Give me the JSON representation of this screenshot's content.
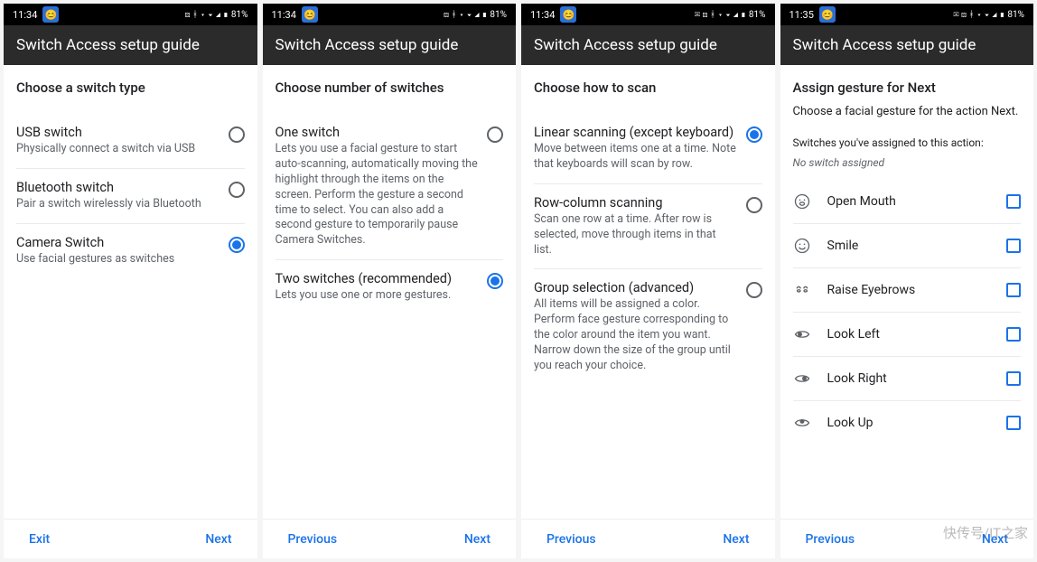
{
  "status": {
    "battery": "81%"
  },
  "appbar_title": "Switch Access setup guide",
  "footer": {
    "exit": "Exit",
    "prev": "Previous",
    "next": "Next"
  },
  "screen1": {
    "time": "11:34",
    "heading": "Choose a switch type",
    "options": [
      {
        "title": "USB switch",
        "desc": "Physically connect a switch via USB",
        "selected": false
      },
      {
        "title": "Bluetooth switch",
        "desc": "Pair a switch wirelessly via Bluetooth",
        "selected": false
      },
      {
        "title": "Camera Switch",
        "desc": "Use facial gestures as switches",
        "selected": true
      }
    ]
  },
  "screen2": {
    "time": "11:34",
    "heading": "Choose number of switches",
    "options": [
      {
        "title": "One switch",
        "desc": "Lets you use a facial gesture to start auto-scanning, automatically moving the highlight through the items on the screen. Perform the gesture a second time to select. You can also add a second gesture to temporarily pause Camera Switches.",
        "selected": false
      },
      {
        "title": "Two switches (recommended)",
        "desc": "Lets you use one or more gestures.",
        "selected": true
      }
    ]
  },
  "screen3": {
    "time": "11:34",
    "heading": "Choose how to scan",
    "options": [
      {
        "title": "Linear scanning (except keyboard)",
        "desc": "Move between items one at a time. Note that keyboards will scan by row.",
        "selected": true
      },
      {
        "title": "Row-column scanning",
        "desc": "Scan one row at a time. After row is selected, move through items in that list.",
        "selected": false
      },
      {
        "title": "Group selection (advanced)",
        "desc": "All items will be assigned a color. Perform face gesture corresponding to the color around the item you want. Narrow down the size of the group until you reach your choice.",
        "selected": false
      }
    ]
  },
  "screen4": {
    "time": "11:35",
    "heading": "Assign gesture for Next",
    "sub": "Choose a facial gesture for the action Next.",
    "note": "Switches you've assigned to this action:",
    "empty": "No switch assigned",
    "gestures": [
      {
        "label": "Open Mouth",
        "icon": "open-mouth"
      },
      {
        "label": "Smile",
        "icon": "smile"
      },
      {
        "label": "Raise Eyebrows",
        "icon": "eyebrows"
      },
      {
        "label": "Look Left",
        "icon": "look-left"
      },
      {
        "label": "Look Right",
        "icon": "look-right"
      },
      {
        "label": "Look Up",
        "icon": "look-up"
      }
    ]
  },
  "watermark": "快传号/IT之家"
}
